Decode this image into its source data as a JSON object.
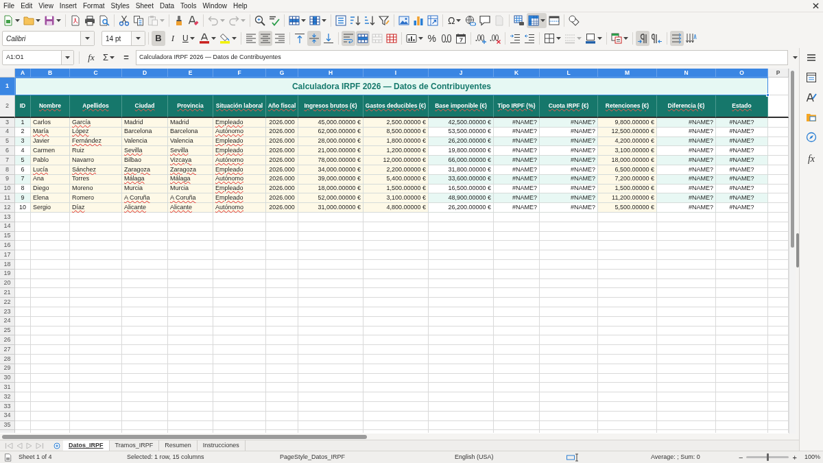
{
  "menu_bar": {
    "items": [
      "File",
      "Edit",
      "View",
      "Insert",
      "Format",
      "Styles",
      "Sheet",
      "Data",
      "Tools",
      "Window",
      "Help"
    ]
  },
  "standard_toolbar": {
    "paste_enabled": false,
    "undo_enabled": false,
    "redo_enabled": false,
    "headers_footers_enabled": false,
    "special_character": "Ω",
    "freeze_panes": true
  },
  "formatting_toolbar": {
    "font_name": "Calibri",
    "font_size": "14 pt",
    "bold": {
      "label": "B",
      "pressed": true
    },
    "italic": {
      "label": "I",
      "pressed": false
    },
    "underline": {
      "label": "U",
      "pressed": false
    },
    "align_left": false,
    "align_center": true,
    "align_right": false,
    "align_top": false,
    "align_middle": true,
    "align_bottom": false,
    "wrap_text": true,
    "merge_and_center": true,
    "merge_cells_enabled": false,
    "percent": "%",
    "border_style_enabled": false,
    "left_to_right": true,
    "right_to_left": false,
    "text_horizontal": true,
    "text_vertical": false
  },
  "formula_bar": {
    "name_box": "A1:O1",
    "function_wizard": "fx",
    "sum": "Σ",
    "formula": "=",
    "content": "Calculadora IRPF 2026 — Datos de Contribuyentes"
  },
  "sidebar": {
    "functions": "fx"
  },
  "sheet": {
    "column_headers": [
      {
        "label": "A",
        "selected": true
      },
      {
        "label": "B",
        "selected": true
      },
      {
        "label": "C",
        "selected": true
      },
      {
        "label": "D",
        "selected": true
      },
      {
        "label": "E",
        "selected": true
      },
      {
        "label": "F",
        "selected": true
      },
      {
        "label": "G",
        "selected": true
      },
      {
        "label": "H",
        "selected": true
      },
      {
        "label": "I",
        "selected": true
      },
      {
        "label": "J",
        "selected": true
      },
      {
        "label": "K",
        "selected": true
      },
      {
        "label": "L",
        "selected": true
      },
      {
        "label": "M",
        "selected": true
      },
      {
        "label": "N",
        "selected": true
      },
      {
        "label": "O",
        "selected": true
      },
      {
        "label": "P",
        "selected": false
      }
    ],
    "row_headers": [
      {
        "label": "1",
        "selected": true
      },
      {
        "label": "2",
        "selected": false
      },
      {
        "label": "3",
        "selected": false
      },
      {
        "label": "4",
        "selected": false
      },
      {
        "label": "5",
        "selected": false
      },
      {
        "label": "6",
        "selected": false
      },
      {
        "label": "7",
        "selected": false
      },
      {
        "label": "8",
        "selected": false
      },
      {
        "label": "9",
        "selected": false
      },
      {
        "label": "10",
        "selected": false
      },
      {
        "label": "11",
        "selected": false
      },
      {
        "label": "12",
        "selected": false
      },
      {
        "label": "13",
        "selected": false
      },
      {
        "label": "14",
        "selected": false
      },
      {
        "label": "15",
        "selected": false
      },
      {
        "label": "16",
        "selected": false
      },
      {
        "label": "17",
        "selected": false
      },
      {
        "label": "18",
        "selected": false
      },
      {
        "label": "19",
        "selected": false
      },
      {
        "label": "20",
        "selected": false
      },
      {
        "label": "21",
        "selected": false
      },
      {
        "label": "22",
        "selected": false
      },
      {
        "label": "23",
        "selected": false
      },
      {
        "label": "24",
        "selected": false
      },
      {
        "label": "25",
        "selected": false
      },
      {
        "label": "26",
        "selected": false
      },
      {
        "label": "27",
        "selected": false
      },
      {
        "label": "28",
        "selected": false
      },
      {
        "label": "29",
        "selected": false
      },
      {
        "label": "30",
        "selected": false
      },
      {
        "label": "31",
        "selected": false
      },
      {
        "label": "32",
        "selected": false
      },
      {
        "label": "33",
        "selected": false
      },
      {
        "label": "34",
        "selected": false
      },
      {
        "label": "35",
        "selected": false
      }
    ],
    "title": "Calculadora IRPF 2026 — Datos de Contribuyentes",
    "columns": [
      {
        "label": "ID",
        "kind": "computed",
        "spell_error": false
      },
      {
        "label": "Nombre",
        "kind": "input",
        "spell_error": true
      },
      {
        "label": "Apellidos",
        "kind": "input",
        "spell_error": true
      },
      {
        "label": "Ciudad",
        "kind": "input",
        "spell_error": true
      },
      {
        "label": "Provincia",
        "kind": "input",
        "spell_error": true
      },
      {
        "label": "Situación laboral",
        "kind": "input",
        "spell_error": true
      },
      {
        "label": "Año fiscal",
        "kind": "input",
        "spell_error": true
      },
      {
        "label": "Ingresos brutos (€)",
        "kind": "input",
        "spell_error": true
      },
      {
        "label": "Gastos deducibles (€)",
        "kind": "input",
        "spell_error": true
      },
      {
        "label": "Base imponible (€)",
        "kind": "computed",
        "spell_error": true
      },
      {
        "label": "Tipo IRPF (%)",
        "kind": "computed",
        "spell_error": true
      },
      {
        "label": "Cuota IRPF (€)",
        "kind": "computed",
        "spell_error": true
      },
      {
        "label": "Retenciones (€)",
        "kind": "input",
        "spell_error": true
      },
      {
        "label": "Diferencia (€)",
        "kind": "computed",
        "spell_error": true
      },
      {
        "label": "Estado",
        "kind": "computed",
        "spell_error": true
      }
    ],
    "rows": [
      [
        {
          "text": "1",
          "spell_error": false
        },
        {
          "text": "Carlos",
          "spell_error": false
        },
        {
          "text": "García",
          "spell_error": true
        },
        {
          "text": "Madrid",
          "spell_error": false
        },
        {
          "text": "Madrid",
          "spell_error": false
        },
        {
          "text": "Empleado",
          "spell_error": true
        },
        {
          "text": "2026.000",
          "spell_error": false
        },
        {
          "text": "45,000.00000 €",
          "spell_error": false
        },
        {
          "text": "2,500.00000 €",
          "spell_error": false
        },
        {
          "text": "42,500.00000 €",
          "spell_error": false
        },
        {
          "text": "#NAME?",
          "spell_error": false
        },
        {
          "text": "#NAME?",
          "spell_error": false
        },
        {
          "text": "9,800.00000 €",
          "spell_error": false
        },
        {
          "text": "#NAME?",
          "spell_error": false
        },
        {
          "text": "#NAME?",
          "spell_error": false
        }
      ],
      [
        {
          "text": "2",
          "spell_error": false
        },
        {
          "text": "María",
          "spell_error": true
        },
        {
          "text": "López",
          "spell_error": true
        },
        {
          "text": "Barcelona",
          "spell_error": false
        },
        {
          "text": "Barcelona",
          "spell_error": false
        },
        {
          "text": "Autónomo",
          "spell_error": true
        },
        {
          "text": "2026.000",
          "spell_error": false
        },
        {
          "text": "62,000.00000 €",
          "spell_error": false
        },
        {
          "text": "8,500.00000 €",
          "spell_error": false
        },
        {
          "text": "53,500.00000 €",
          "spell_error": false
        },
        {
          "text": "#NAME?",
          "spell_error": false
        },
        {
          "text": "#NAME?",
          "spell_error": false
        },
        {
          "text": "12,500.00000 €",
          "spell_error": false
        },
        {
          "text": "#NAME?",
          "spell_error": false
        },
        {
          "text": "#NAME?",
          "spell_error": false
        }
      ],
      [
        {
          "text": "3",
          "spell_error": false
        },
        {
          "text": "Javier",
          "spell_error": false
        },
        {
          "text": "Fernández",
          "spell_error": true
        },
        {
          "text": "Valencia",
          "spell_error": false
        },
        {
          "text": "Valencia",
          "spell_error": false
        },
        {
          "text": "Empleado",
          "spell_error": true
        },
        {
          "text": "2026.000",
          "spell_error": false
        },
        {
          "text": "28,000.00000 €",
          "spell_error": false
        },
        {
          "text": "1,800.00000 €",
          "spell_error": false
        },
        {
          "text": "26,200.00000 €",
          "spell_error": false
        },
        {
          "text": "#NAME?",
          "spell_error": false
        },
        {
          "text": "#NAME?",
          "spell_error": false
        },
        {
          "text": "4,200.00000 €",
          "spell_error": false
        },
        {
          "text": "#NAME?",
          "spell_error": false
        },
        {
          "text": "#NAME?",
          "spell_error": false
        }
      ],
      [
        {
          "text": "4",
          "spell_error": false
        },
        {
          "text": "Carmen",
          "spell_error": false
        },
        {
          "text": "Ruiz",
          "spell_error": false
        },
        {
          "text": "Sevilla",
          "spell_error": true
        },
        {
          "text": "Sevilla",
          "spell_error": true
        },
        {
          "text": "Empleado",
          "spell_error": true
        },
        {
          "text": "2026.000",
          "spell_error": false
        },
        {
          "text": "21,000.00000 €",
          "spell_error": false
        },
        {
          "text": "1,200.00000 €",
          "spell_error": false
        },
        {
          "text": "19,800.00000 €",
          "spell_error": false
        },
        {
          "text": "#NAME?",
          "spell_error": false
        },
        {
          "text": "#NAME?",
          "spell_error": false
        },
        {
          "text": "3,100.00000 €",
          "spell_error": false
        },
        {
          "text": "#NAME?",
          "spell_error": false
        },
        {
          "text": "#NAME?",
          "spell_error": false
        }
      ],
      [
        {
          "text": "5",
          "spell_error": false
        },
        {
          "text": "Pablo",
          "spell_error": false
        },
        {
          "text": "Navarro",
          "spell_error": false
        },
        {
          "text": "Bilbao",
          "spell_error": false
        },
        {
          "text": "Vizcaya",
          "spell_error": true
        },
        {
          "text": "Autónomo",
          "spell_error": true
        },
        {
          "text": "2026.000",
          "spell_error": false
        },
        {
          "text": "78,000.00000 €",
          "spell_error": false
        },
        {
          "text": "12,000.00000 €",
          "spell_error": false
        },
        {
          "text": "66,000.00000 €",
          "spell_error": false
        },
        {
          "text": "#NAME?",
          "spell_error": false
        },
        {
          "text": "#NAME?",
          "spell_error": false
        },
        {
          "text": "18,000.00000 €",
          "spell_error": false
        },
        {
          "text": "#NAME?",
          "spell_error": false
        },
        {
          "text": "#NAME?",
          "spell_error": false
        }
      ],
      [
        {
          "text": "6",
          "spell_error": false
        },
        {
          "text": "Lucía",
          "spell_error": true
        },
        {
          "text": "Sánchez",
          "spell_error": true
        },
        {
          "text": "Zaragoza",
          "spell_error": true
        },
        {
          "text": "Zaragoza",
          "spell_error": true
        },
        {
          "text": "Empleado",
          "spell_error": true
        },
        {
          "text": "2026.000",
          "spell_error": false
        },
        {
          "text": "34,000.00000 €",
          "spell_error": false
        },
        {
          "text": "2,200.00000 €",
          "spell_error": false
        },
        {
          "text": "31,800.00000 €",
          "spell_error": false
        },
        {
          "text": "#NAME?",
          "spell_error": false
        },
        {
          "text": "#NAME?",
          "spell_error": false
        },
        {
          "text": "6,500.00000 €",
          "spell_error": false
        },
        {
          "text": "#NAME?",
          "spell_error": false
        },
        {
          "text": "#NAME?",
          "spell_error": false
        }
      ],
      [
        {
          "text": "7",
          "spell_error": false
        },
        {
          "text": "Ana",
          "spell_error": false
        },
        {
          "text": "Torres",
          "spell_error": false
        },
        {
          "text": "Málaga",
          "spell_error": true
        },
        {
          "text": "Málaga",
          "spell_error": true
        },
        {
          "text": "Autónomo",
          "spell_error": true
        },
        {
          "text": "2026.000",
          "spell_error": false
        },
        {
          "text": "39,000.00000 €",
          "spell_error": false
        },
        {
          "text": "5,400.00000 €",
          "spell_error": false
        },
        {
          "text": "33,600.00000 €",
          "spell_error": false
        },
        {
          "text": "#NAME?",
          "spell_error": false
        },
        {
          "text": "#NAME?",
          "spell_error": false
        },
        {
          "text": "7,200.00000 €",
          "spell_error": false
        },
        {
          "text": "#NAME?",
          "spell_error": false
        },
        {
          "text": "#NAME?",
          "spell_error": false
        }
      ],
      [
        {
          "text": "8",
          "spell_error": false
        },
        {
          "text": "Diego",
          "spell_error": false
        },
        {
          "text": "Moreno",
          "spell_error": false
        },
        {
          "text": "Murcia",
          "spell_error": false
        },
        {
          "text": "Murcia",
          "spell_error": false
        },
        {
          "text": "Empleado",
          "spell_error": true
        },
        {
          "text": "2026.000",
          "spell_error": false
        },
        {
          "text": "18,000.00000 €",
          "spell_error": false
        },
        {
          "text": "1,500.00000 €",
          "spell_error": false
        },
        {
          "text": "16,500.00000 €",
          "spell_error": false
        },
        {
          "text": "#NAME?",
          "spell_error": false
        },
        {
          "text": "#NAME?",
          "spell_error": false
        },
        {
          "text": "1,500.00000 €",
          "spell_error": false
        },
        {
          "text": "#NAME?",
          "spell_error": false
        },
        {
          "text": "#NAME?",
          "spell_error": false
        }
      ],
      [
        {
          "text": "9",
          "spell_error": false
        },
        {
          "text": "Elena",
          "spell_error": false
        },
        {
          "text": "Romero",
          "spell_error": false
        },
        {
          "text": "A Coruña",
          "spell_error": true
        },
        {
          "text": "A Coruña",
          "spell_error": true
        },
        {
          "text": "Empleado",
          "spell_error": true
        },
        {
          "text": "2026.000",
          "spell_error": false
        },
        {
          "text": "52,000.00000 €",
          "spell_error": false
        },
        {
          "text": "3,100.00000 €",
          "spell_error": false
        },
        {
          "text": "48,900.00000 €",
          "spell_error": false
        },
        {
          "text": "#NAME?",
          "spell_error": false
        },
        {
          "text": "#NAME?",
          "spell_error": false
        },
        {
          "text": "11,200.00000 €",
          "spell_error": false
        },
        {
          "text": "#NAME?",
          "spell_error": false
        },
        {
          "text": "#NAME?",
          "spell_error": false
        }
      ],
      [
        {
          "text": "10",
          "spell_error": false
        },
        {
          "text": "Sergio",
          "spell_error": false
        },
        {
          "text": "Díaz",
          "spell_error": true
        },
        {
          "text": "Alicante",
          "spell_error": true
        },
        {
          "text": "Alicante",
          "spell_error": true
        },
        {
          "text": "Autónomo",
          "spell_error": true
        },
        {
          "text": "2026.000",
          "spell_error": false
        },
        {
          "text": "31,000.00000 €",
          "spell_error": false
        },
        {
          "text": "4,800.00000 €",
          "spell_error": false
        },
        {
          "text": "26,200.00000 €",
          "spell_error": false
        },
        {
          "text": "#NAME?",
          "spell_error": false
        },
        {
          "text": "#NAME?",
          "spell_error": false
        },
        {
          "text": "5,500.00000 €",
          "spell_error": false
        },
        {
          "text": "#NAME?",
          "spell_error": false
        },
        {
          "text": "#NAME?",
          "spell_error": false
        }
      ]
    ]
  },
  "sheet_tabs": {
    "navigation_enabled": false,
    "tabs": [
      {
        "label": "Datos_IRPF",
        "selected": true
      },
      {
        "label": "Tramos_IRPF",
        "selected": false
      },
      {
        "label": "Resumen",
        "selected": false
      },
      {
        "label": "Instrucciones",
        "selected": false
      }
    ]
  },
  "status_bar": {
    "sheet_position": "Sheet 1 of 4",
    "selection": "Selected: 1 row, 15 columns",
    "page_style": "PageStyle_Datos_IRPF",
    "language": "English (USA)",
    "summary": "Average: ; Sum: 0",
    "zoom": {
      "minus": "−",
      "plus": "+",
      "level": 0.5,
      "value": "100%"
    }
  }
}
